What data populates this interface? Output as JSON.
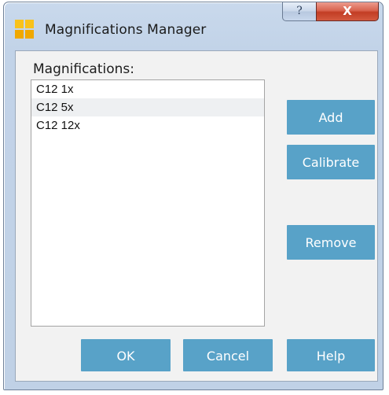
{
  "window": {
    "title": "Magnifications Manager",
    "help_glyph": "?",
    "close_glyph": "X"
  },
  "list": {
    "label": "Magnifications:",
    "items": [
      {
        "label": "C12 1x"
      },
      {
        "label": "C12 5x"
      },
      {
        "label": "C12 12x"
      }
    ]
  },
  "buttons": {
    "add": "Add",
    "calibrate": "Calibrate",
    "remove": "Remove",
    "ok": "OK",
    "cancel": "Cancel",
    "help": "Help"
  },
  "colors": {
    "button_bg": "#58a2c8",
    "app_icon": "#f5b400",
    "close_button": "#c94a33"
  },
  "icons": {
    "app": "app-grid-icon",
    "help": "question-mark-icon",
    "close": "close-icon"
  }
}
